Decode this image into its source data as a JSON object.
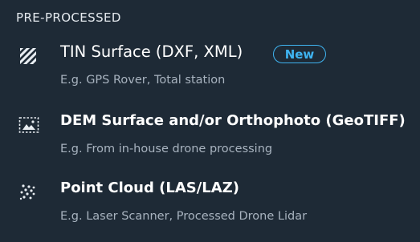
{
  "section": {
    "title": "PRE-PROCESSED"
  },
  "options": [
    {
      "title": "TIN Surface (DXF, XML)",
      "badge": "New",
      "subtitle": "E.g. GPS Rover, Total station",
      "icon": "hatched-square-icon"
    },
    {
      "title": "DEM Surface and/or Orthophoto (GeoTIFF)",
      "subtitle": "E.g. From in-house drone processing",
      "icon": "image-frame-icon"
    },
    {
      "title": "Point Cloud (LAS/LAZ)",
      "subtitle": "E.g. Laser Scanner, Processed Drone Lidar",
      "icon": "point-cloud-icon"
    }
  ],
  "colors": {
    "background": "#1e2a36",
    "text": "#ffffff",
    "subtext": "#a8b3bf",
    "accent": "#3fb3f0"
  }
}
